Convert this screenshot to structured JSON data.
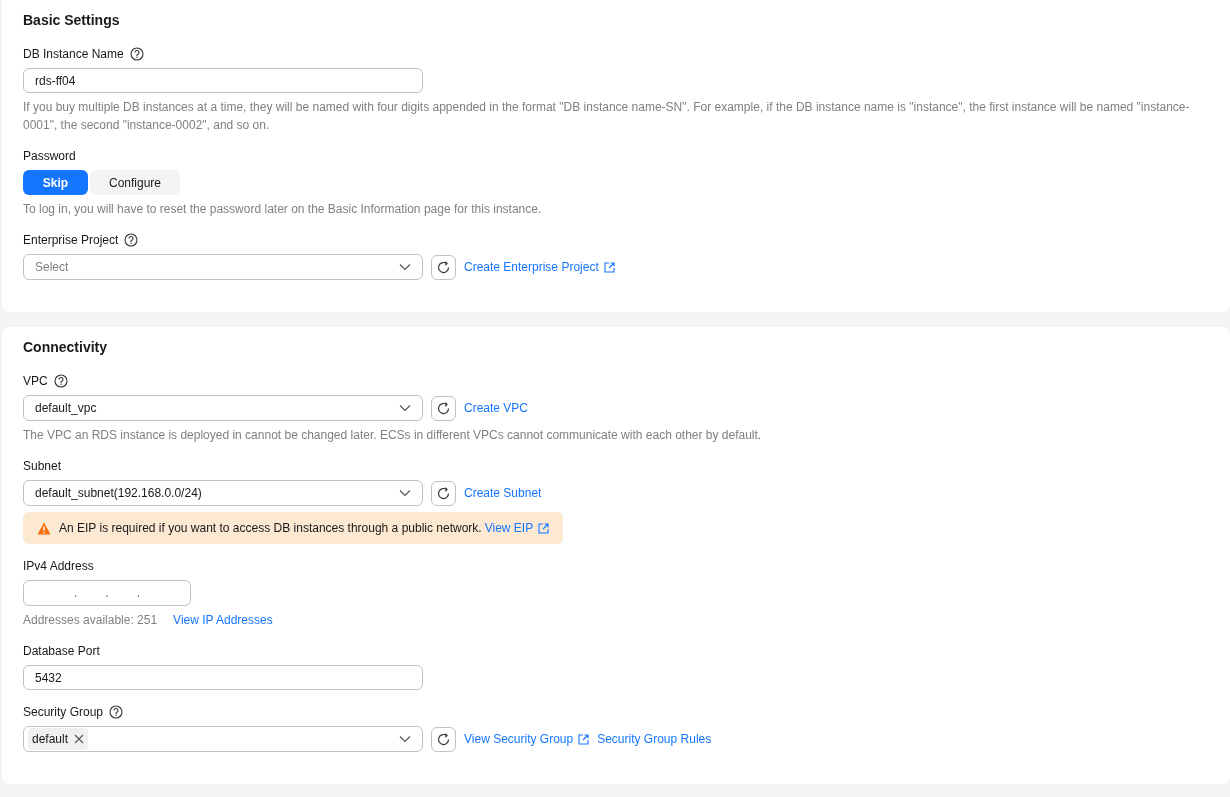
{
  "sections": [
    {
      "title": "Basic Settings",
      "fields": [
        {
          "kind": "text",
          "label": "DB Instance Name",
          "help": true,
          "value": "rds-ff04",
          "hint": "If you buy multiple DB instances at a time, they will be named with four digits appended in the format \"DB instance name-SN\". For example, if the DB instance name is \"instance\", the first instance will be named \"instance-0001\", the second \"instance-0002\", and so on."
        },
        {
          "kind": "segmented",
          "label": "Password",
          "help": false,
          "options": [
            {
              "label": "Skip",
              "selected": true
            },
            {
              "label": "Configure",
              "selected": false
            }
          ],
          "hint": "To log in, you will have to reset the password later on the Basic Information page for this instance."
        },
        {
          "kind": "select",
          "label": "Enterprise Project",
          "help": true,
          "placeholder": "Select",
          "refresh": true,
          "links": [
            {
              "text": "Create Enterprise Project",
              "external": true
            }
          ]
        }
      ]
    },
    {
      "title": "Connectivity",
      "fields": [
        {
          "kind": "select",
          "label": "VPC",
          "help": true,
          "value": "default_vpc",
          "refresh": true,
          "links": [
            {
              "text": "Create VPC",
              "external": false
            }
          ],
          "hint": "The VPC an RDS instance is deployed in cannot be changed later. ECSs in different VPCs cannot communicate with each other by default."
        },
        {
          "kind": "select",
          "label": "Subnet",
          "help": false,
          "value": "default_subnet(192.168.0.0/24)",
          "refresh": true,
          "links": [
            {
              "text": "Create Subnet",
              "external": false
            }
          ],
          "alert": {
            "text": "An EIP is required if you want to access DB instances through a public network.",
            "link": "View EIP"
          }
        },
        {
          "kind": "ipv4",
          "label": "IPv4 Address",
          "help": false,
          "separators": [
            ".",
            ".",
            "."
          ],
          "hint": "Addresses available: 251",
          "hint_link": "View IP Addresses"
        },
        {
          "kind": "text",
          "label": "Database Port",
          "help": false,
          "value": "5432"
        },
        {
          "kind": "select",
          "label": "Security Group",
          "help": true,
          "tags": [
            "default"
          ],
          "refresh": true,
          "links": [
            {
              "text": "View Security Group",
              "external": true
            },
            {
              "text": "Security Group Rules",
              "external": false
            }
          ]
        }
      ]
    }
  ]
}
